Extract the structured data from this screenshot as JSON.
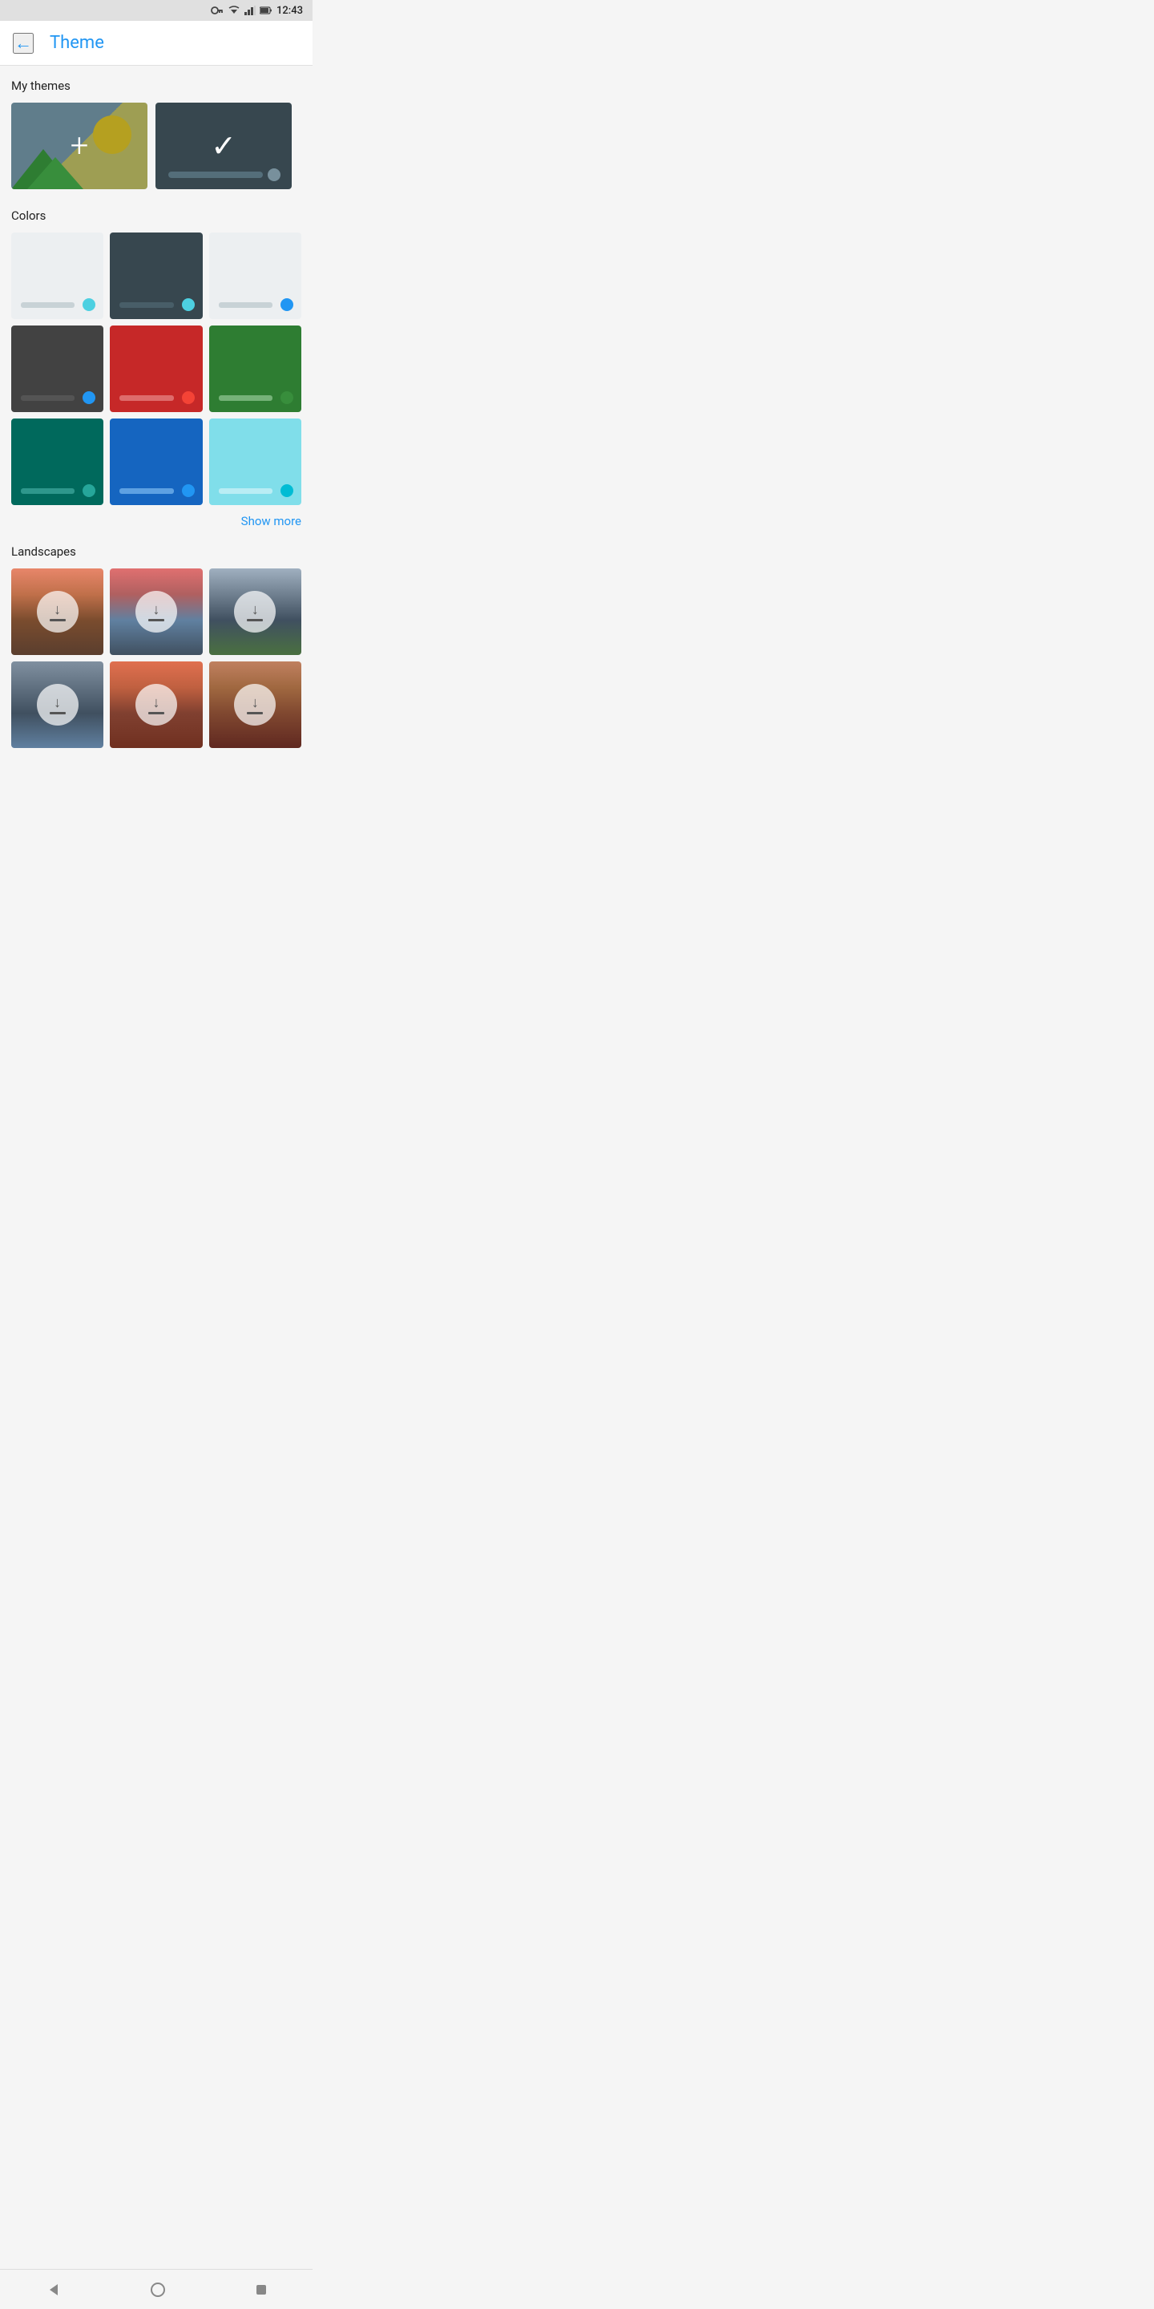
{
  "statusBar": {
    "time": "12:43"
  },
  "header": {
    "backLabel": "←",
    "title": "Theme"
  },
  "myThemes": {
    "sectionTitle": "My themes",
    "cards": [
      {
        "id": "add-new",
        "label": "Add new theme"
      },
      {
        "id": "current",
        "label": "Current theme"
      }
    ]
  },
  "colors": {
    "sectionTitle": "Colors",
    "showMoreLabel": "Show more",
    "items": [
      {
        "id": "color-light-green",
        "bg": "#eceff1",
        "bar": "#b0bec5",
        "dot": "#4dd0e1"
      },
      {
        "id": "color-dark-teal",
        "bg": "#37474f",
        "bar": "#546e7a",
        "dot": "#4dd0e1"
      },
      {
        "id": "color-light-blue-dot",
        "bg": "#eceff1",
        "bar": "#b0bec5",
        "dot": "#2196F3"
      },
      {
        "id": "color-dark-gray",
        "bg": "#424242",
        "bar": "#616161",
        "dot": "#2196F3"
      },
      {
        "id": "color-red",
        "bg": "#c62828",
        "bar": "#e57373",
        "dot": "#f44336"
      },
      {
        "id": "color-green",
        "bg": "#2e7d32",
        "bar": "#81c784",
        "dot": "#388e3c"
      },
      {
        "id": "color-teal",
        "bg": "#00695c",
        "bar": "#4db6ac",
        "dot": "#26a69a"
      },
      {
        "id": "color-blue",
        "bg": "#1565c0",
        "bar": "#64b5f6",
        "dot": "#2196F3"
      },
      {
        "id": "color-cyan",
        "bg": "#80deea",
        "bar": "#b2ebf2",
        "dot": "#00bcd4"
      }
    ]
  },
  "landscapes": {
    "sectionTitle": "Landscapes",
    "items": [
      {
        "id": "landscape-1",
        "bgClass": "landscape-1"
      },
      {
        "id": "landscape-2",
        "bgClass": "landscape-2"
      },
      {
        "id": "landscape-3",
        "bgClass": "landscape-3"
      },
      {
        "id": "landscape-4",
        "bgClass": "landscape-4"
      },
      {
        "id": "landscape-5",
        "bgClass": "landscape-5"
      },
      {
        "id": "landscape-6",
        "bgClass": "landscape-6"
      }
    ]
  },
  "navBar": {
    "backLabel": "◀",
    "homeLabel": "⬤",
    "squareLabel": "■"
  }
}
